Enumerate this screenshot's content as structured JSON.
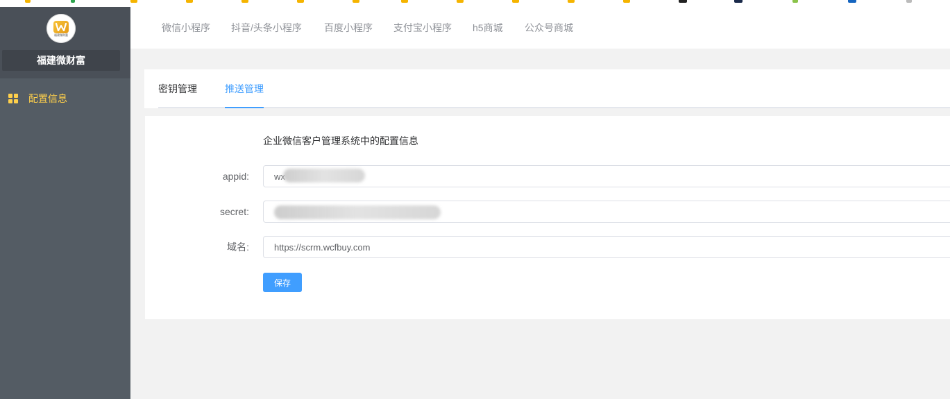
{
  "sidebar": {
    "brand_name": "福建微财富",
    "logo_letter": "W",
    "logo_caption": "福建微财富",
    "menu": [
      {
        "label": "配置信息",
        "icon": "grid-icon"
      }
    ]
  },
  "topnav": {
    "items": [
      "微信小程序",
      "抖音/头条小程序",
      "百度小程序",
      "支付宝小程序",
      "h5商城",
      "公众号商城"
    ]
  },
  "tabs": {
    "items": [
      "密钥管理",
      "推送管理"
    ],
    "active": "推送管理"
  },
  "form": {
    "description": "企业微信客户管理系统中的配置信息",
    "appid_label": "appid:",
    "appid_value": "wx",
    "secret_label": "secret:",
    "secret_value": "",
    "domain_label": "域名:",
    "domain_value": "https://scrm.wcfbuy.com",
    "save_label": "保存"
  },
  "colors": {
    "sidebar_bg": "#545c64",
    "sidebar_active": "#ffd04b",
    "primary": "#409eff",
    "page_bg": "#f2f2f2"
  }
}
